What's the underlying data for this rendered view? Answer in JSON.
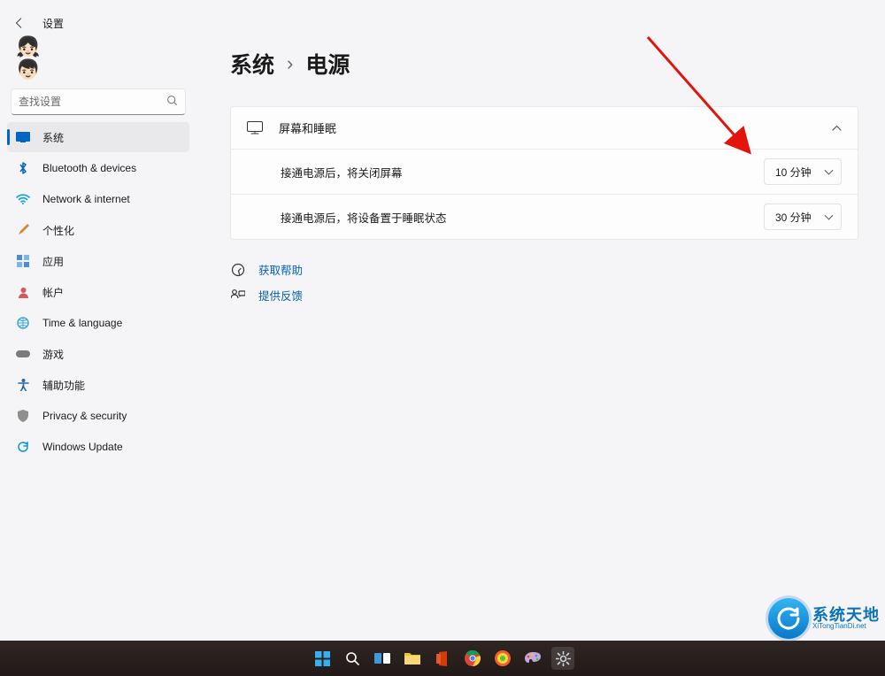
{
  "header": {
    "app_title": "设置"
  },
  "search": {
    "placeholder": "查找设置"
  },
  "sidebar": {
    "items": [
      {
        "label": "系统"
      },
      {
        "label": "Bluetooth & devices"
      },
      {
        "label": "Network & internet"
      },
      {
        "label": "个性化"
      },
      {
        "label": "应用"
      },
      {
        "label": "帐户"
      },
      {
        "label": "Time & language"
      },
      {
        "label": "游戏"
      },
      {
        "label": "辅助功能"
      },
      {
        "label": "Privacy & security"
      },
      {
        "label": "Windows Update"
      }
    ]
  },
  "breadcrumb": {
    "root": "系统",
    "leaf": "电源"
  },
  "panel": {
    "title": "屏幕和睡眠",
    "rows": [
      {
        "label": "接通电源后，将关闭屏幕",
        "value": "10 分钟"
      },
      {
        "label": "接通电源后，将设备置于睡眠状态",
        "value": "30 分钟"
      }
    ]
  },
  "links": {
    "help": "获取帮助",
    "feedback": "提供反馈"
  },
  "watermark": {
    "brand": "系统天地",
    "url": "XiTongTianDi.net"
  }
}
